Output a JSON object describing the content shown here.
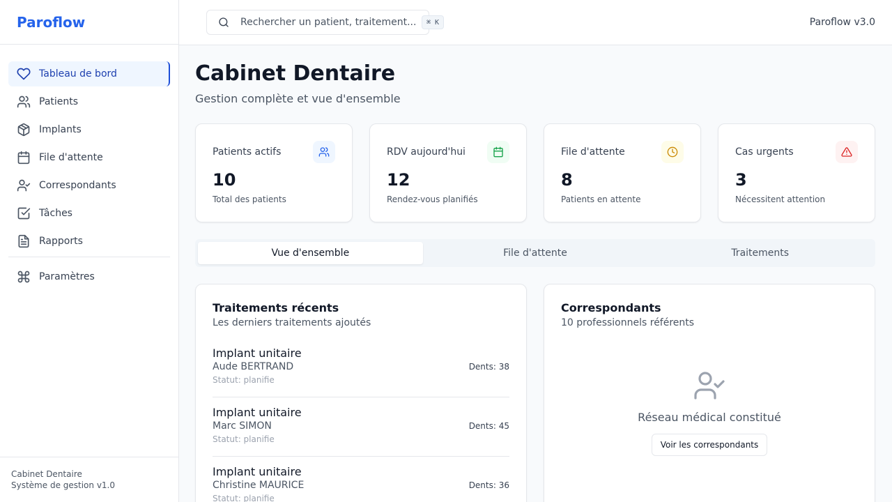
{
  "brand": "Paroflow",
  "sidebar": {
    "items": [
      {
        "label": "Tableau de bord"
      },
      {
        "label": "Patients"
      },
      {
        "label": "Implants"
      },
      {
        "label": "File d'attente"
      },
      {
        "label": "Correspondants"
      },
      {
        "label": "Tâches"
      },
      {
        "label": "Rapports"
      },
      {
        "label": "Paramètres"
      }
    ],
    "footer_line1": "Cabinet Dentaire",
    "footer_line2": "Système de gestion v1.0"
  },
  "header": {
    "search_placeholder": "Rechercher un patient, traitement...",
    "shortcut": "⌘ K",
    "version": "Paroflow v3.0"
  },
  "page": {
    "title": "Cabinet Dentaire",
    "subtitle": "Gestion complète et vue d'ensemble"
  },
  "stats": [
    {
      "label": "Patients actifs",
      "value": "10",
      "desc": "Total des patients",
      "icon": "users-icon",
      "color": "#2563eb",
      "bg": "#eff6ff"
    },
    {
      "label": "RDV aujourd'hui",
      "value": "12",
      "desc": "Rendez-vous planifiés",
      "icon": "calendar-icon",
      "color": "#16a34a",
      "bg": "#f0fdf4"
    },
    {
      "label": "File d'attente",
      "value": "8",
      "desc": "Patients en attente",
      "icon": "clock-icon",
      "color": "#ca8a04",
      "bg": "#fefce8"
    },
    {
      "label": "Cas urgents",
      "value": "3",
      "desc": "Nécessitent attention",
      "icon": "alert-triangle-icon",
      "color": "#dc2626",
      "bg": "#fef2f2"
    }
  ],
  "tabs": [
    {
      "label": "Vue d'ensemble"
    },
    {
      "label": "File d'attente"
    },
    {
      "label": "Traitements"
    }
  ],
  "treatments": {
    "title": "Traitements récents",
    "subtitle": "Les derniers traitements ajoutés",
    "items": [
      {
        "name": "Implant unitaire",
        "patient": "Aude BERTRAND",
        "status": "Statut: planifie",
        "teeth": "Dents: 38"
      },
      {
        "name": "Implant unitaire",
        "patient": "Marc SIMON",
        "status": "Statut: planifie",
        "teeth": "Dents: 45"
      },
      {
        "name": "Implant unitaire",
        "patient": "Christine MAURICE",
        "status": "Statut: planifie",
        "teeth": "Dents: 36"
      }
    ]
  },
  "correspondants": {
    "title": "Correspondants",
    "subtitle": "10 professionnels référents",
    "empty_message": "Réseau médical constitué",
    "button": "Voir les correspondants"
  }
}
